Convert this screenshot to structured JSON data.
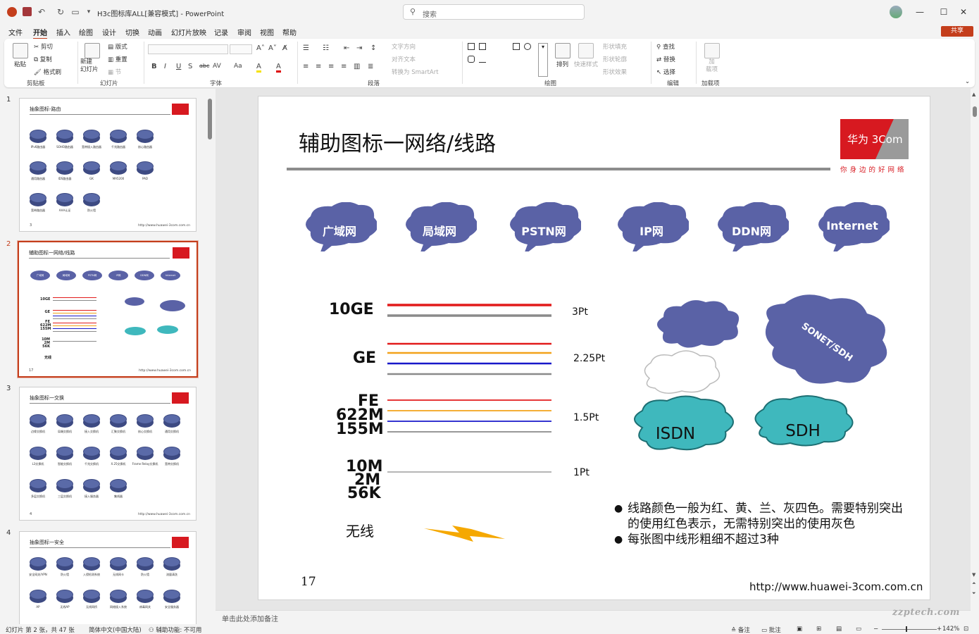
{
  "window": {
    "doc_title": "H3c图标库ALL[兼容模式]  -  PowerPoint",
    "search_placeholder": "搜索"
  },
  "menu": {
    "tabs": [
      "文件",
      "开始",
      "插入",
      "绘图",
      "设计",
      "切换",
      "动画",
      "幻灯片放映",
      "记录",
      "审阅",
      "视图",
      "帮助"
    ],
    "active": "开始",
    "share": "共享"
  },
  "ribbon": {
    "clipboard": {
      "paste": "粘贴",
      "cut": "剪切",
      "copy": "复制",
      "format_painter": "格式刷",
      "label": "剪贴板"
    },
    "slides": {
      "new_slide": "新建\n幻灯片",
      "layout": "版式",
      "reset": "重置",
      "section": "节",
      "label": "幻灯片"
    },
    "font": {
      "label": "字体",
      "buttons": [
        "B",
        "I",
        "U",
        "S",
        "abc",
        "AV",
        "Aa",
        "A",
        "A"
      ]
    },
    "paragraph": {
      "text_direction": "文字方向",
      "align_text": "对齐文本",
      "smartart": "转换为 SmartArt",
      "label": "段落"
    },
    "drawing": {
      "arrange": "排列",
      "quick_styles": "快速样式",
      "shape_fill": "形状填充",
      "shape_outline": "形状轮廓",
      "shape_effects": "形状效果",
      "label": "绘图"
    },
    "editing": {
      "find": "查找",
      "replace": "替换",
      "select": "选择",
      "label": "编辑"
    },
    "addins": {
      "addins": "加\n载项",
      "label": "加载项"
    }
  },
  "thumbnails": [
    {
      "num": "1",
      "title": "抽象图标-路由",
      "page": "3",
      "url": "http://www.huawei-3com.com.cn",
      "icons": [
        "IPv6路由器",
        "SOHO路由器",
        "宽带接入路由器",
        "千兆路由器",
        "核心路由器",
        "通用路由器",
        "IDS路由器",
        "GK",
        "MA5200",
        "PAD",
        "宽带路由器",
        "AAA认证",
        "防火墙"
      ]
    },
    {
      "num": "2",
      "title": "辅助图标一网络/线路",
      "page": "17",
      "url": "http://www.huawei-3com.com.cn",
      "clouds": [
        "广域网",
        "局域网",
        "PSTN网",
        "IP网",
        "DDN网",
        "Internet"
      ],
      "rows": [
        "10GE",
        "GE",
        "FE",
        "622M",
        "155M",
        "10M",
        "2M",
        "56K",
        "无线"
      ]
    },
    {
      "num": "3",
      "title": "抽象图标一交换",
      "page": "4",
      "url": "http://www.huawei-3com.com.cn",
      "icons": [
        "边缘交换机",
        "局端交换机",
        "接入交换机",
        "汇聚交换机",
        "核心交换机",
        "通用交换机",
        "L3交换机",
        "智能交换机",
        "千兆交换机",
        "X.25交换机",
        "Frame Relay交换机",
        "宽带交换机",
        "多层交换机",
        "三层交换机",
        "接入服务器",
        "集线器"
      ]
    },
    {
      "num": "4",
      "title": "抽象图标一安全",
      "page": "",
      "url": "",
      "icons": [
        "安全网关/VPN",
        "防火墙",
        "入侵检测系统",
        "无线网卡",
        "防火墙",
        "流量清洗",
        "AP",
        "无线AP",
        "无线网桥",
        "网络接入系统",
        "病毒网关",
        "安全服务器"
      ]
    }
  ],
  "slide": {
    "title": "辅助图标一网络/线路",
    "logo_text": "华为 3Com",
    "logo_slogan": "你身边的好网络",
    "clouds": [
      "广域网",
      "局域网",
      "PSTN网",
      "IP网",
      "DDN网",
      "Internet"
    ],
    "row_labels": [
      "10GE",
      "GE",
      "FE",
      "622M",
      "155M",
      "10M",
      "2M",
      "56K",
      "无线"
    ],
    "weights": [
      "3Pt",
      "2.25Pt",
      "1.5Pt",
      "1Pt"
    ],
    "right_clouds": {
      "sonet": "SONET/SDH",
      "isdn": "ISDN",
      "sdh": "SDH"
    },
    "bullets": [
      "线路颜色一般为红、黄、兰、灰四色。需要特别突出的使用红色表示，无需特别突出的使用灰色",
      "每张图中线形粗细不超过3种"
    ],
    "page_number": "17",
    "url": "http://www.huawei-3com.com.cn",
    "colors": {
      "red": "#e21b1b",
      "yellow": "#f2a21a",
      "blue": "#1818c9",
      "gray": "#8a8a8a",
      "cloud": "#5a62a6",
      "teal": "#3fb8bd"
    }
  },
  "notes_placeholder": "单击此处添加备注",
  "status": {
    "slide_info": "幻灯片 第 2 张，共 47 张",
    "language": "简体中文(中国大陆)",
    "accessibility": "辅助功能: 不可用",
    "notes": "备注",
    "comments": "批注",
    "zoom": "142%"
  },
  "watermark": "zzptech.com"
}
